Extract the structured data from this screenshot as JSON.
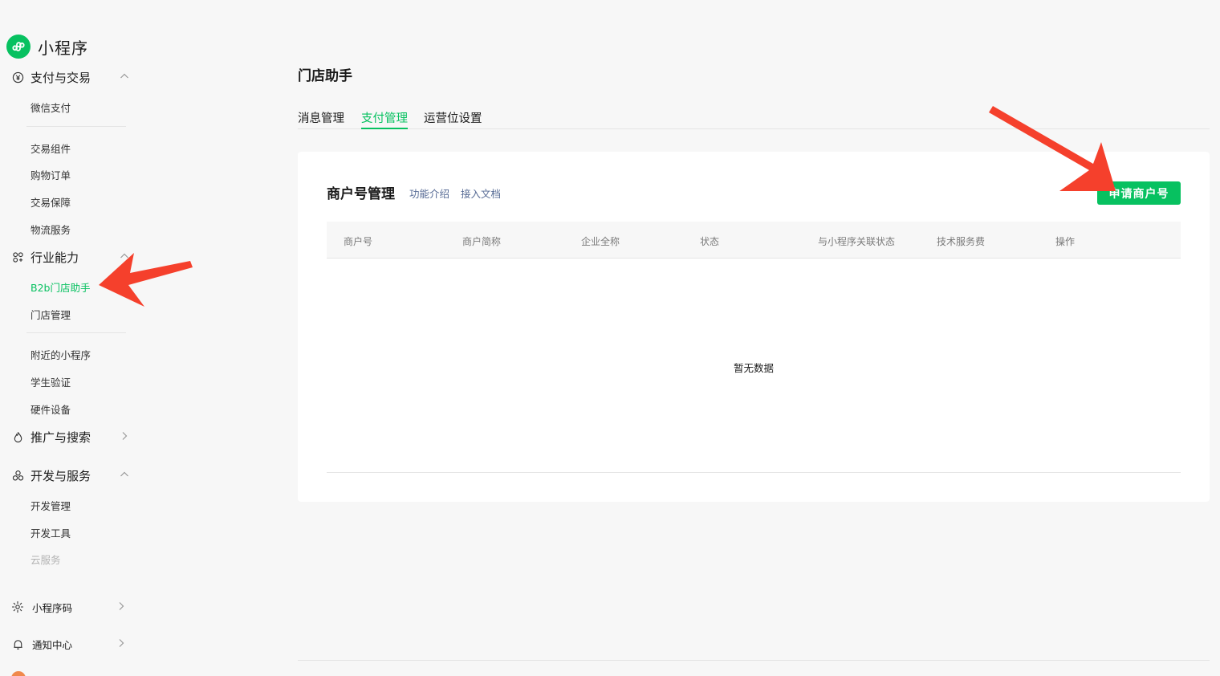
{
  "app": {
    "name": "小程序"
  },
  "sidebar": {
    "groups": {
      "pay": {
        "label": "支付与交易",
        "items": [
          "微信支付",
          "交易组件",
          "购物订单",
          "交易保障",
          "物流服务"
        ]
      },
      "industry": {
        "label": "行业能力",
        "items": [
          "B2b门店助手",
          "门店管理",
          "附近的小程序",
          "学生验证",
          "硬件设备"
        ],
        "active_item": "B2b门店助手"
      },
      "promo": {
        "label": "推广与搜索"
      },
      "dev": {
        "label": "开发与服务",
        "items": [
          "开发管理",
          "开发工具",
          "云服务"
        ]
      },
      "qrcode": {
        "label": "小程序码"
      },
      "notify": {
        "label": "通知中心"
      }
    }
  },
  "main": {
    "title": "门店助手",
    "tabs": [
      "消息管理",
      "支付管理",
      "运营位设置"
    ],
    "active_tab": "支付管理",
    "card": {
      "title": "商户号管理",
      "links": [
        "功能介绍",
        "接入文档"
      ],
      "apply_button": "申请商户号",
      "columns": [
        "商户号",
        "商户简称",
        "企业全称",
        "状态",
        "与小程序关联状态",
        "技术服务费",
        "操作"
      ],
      "empty_text": "暂无数据"
    }
  },
  "colors": {
    "brand": "#07c160",
    "link": "#576b95",
    "arrow": "#f5402c"
  }
}
